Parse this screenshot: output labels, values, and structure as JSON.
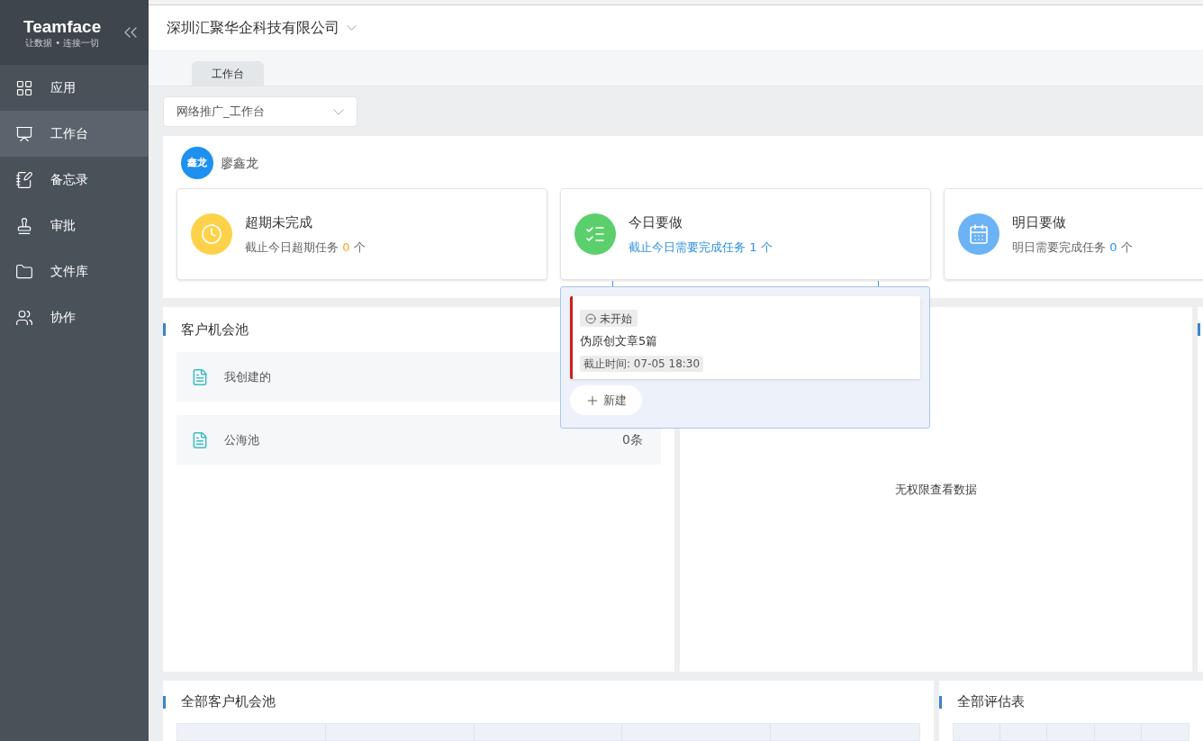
{
  "sidebar": {
    "logo": "Teamface",
    "slogan": "让数据 • 连接一切",
    "items": [
      {
        "label": "应用",
        "kind": "apps",
        "selected": false
      },
      {
        "label": "工作台",
        "kind": "workbench",
        "selected": true
      },
      {
        "label": "备忘录",
        "kind": "memo",
        "selected": false
      },
      {
        "label": "审批",
        "kind": "approval",
        "selected": false
      },
      {
        "label": "文件库",
        "kind": "files",
        "selected": false
      },
      {
        "label": "协作",
        "kind": "collab",
        "selected": false
      }
    ]
  },
  "header": {
    "company": "深圳汇聚华企科技有限公司"
  },
  "tabs": [
    {
      "label": "工作台",
      "selected": true
    }
  ],
  "workbench_select": {
    "value": "网络推广_工作台"
  },
  "user": {
    "avatar": "鑫龙",
    "name": "廖鑫龙"
  },
  "stat_cards": [
    {
      "kind": "overdue",
      "title": "超期未完成",
      "text": "截止今日超期任务",
      "count": "0",
      "unit": "个",
      "color": "#f5a623",
      "active": false
    },
    {
      "kind": "today",
      "title": "今日要做",
      "text": "截止今日需要完成任务",
      "count": "1",
      "unit": "个",
      "color": "#2f8fe0",
      "active": true
    },
    {
      "kind": "tomorrow",
      "title": "明日要做",
      "text": "明日需要完成任务",
      "count": "0",
      "unit": "个",
      "color": "#2f8fe0",
      "active": false
    }
  ],
  "popover": {
    "tasks": [
      {
        "status": "未开始",
        "title": "伪原创文章5篇",
        "deadline": "截止时间: 07-05 18:30"
      }
    ],
    "new_button": "新建"
  },
  "pool_panel": {
    "title": "客户机会池",
    "rows": [
      {
        "label": "我创建的"
      },
      {
        "label": "公海池",
        "count": "0条"
      }
    ]
  },
  "middle_panel": {
    "message": "无权限查看数据"
  },
  "bottom_panels": [
    {
      "title": "全部客户机会池"
    },
    {
      "title": "全部评估表"
    }
  ]
}
